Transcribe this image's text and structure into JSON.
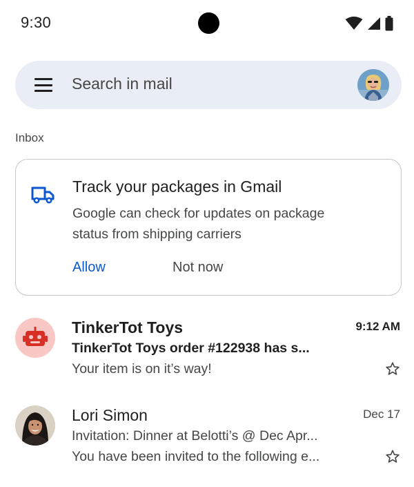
{
  "status_bar": {
    "time": "9:30",
    "icons": [
      "wifi-icon",
      "cell-signal-icon",
      "battery-icon"
    ]
  },
  "search": {
    "placeholder": "Search in mail",
    "menu_icon": "hamburger-menu-icon",
    "account_avatar": "account-avatar"
  },
  "section_label": "Inbox",
  "promo": {
    "icon": "truck-icon",
    "title": "Track your packages in Gmail",
    "body": "Google can check for updates on package status from shipping carriers",
    "allow_label": "Allow",
    "dismiss_label": "Not now"
  },
  "emails": [
    {
      "sender": "TinkerTot Toys",
      "date": "9:12 AM",
      "subject": "TinkerTot Toys order #122938 has s...",
      "snippet": "Your item is on it’s way!",
      "unread": true,
      "avatar": "robot-icon"
    },
    {
      "sender": "Lori Simon",
      "date": "Dec 17",
      "subject": "Invitation: Dinner at Belotti’s @ Dec Apr...",
      "snippet": "You have been invited to the following e...",
      "unread": false,
      "avatar": "contact-photo"
    }
  ],
  "colors": {
    "accent": "#0b57d0",
    "search_bg": "#e9eef6",
    "robot_avatar_bg": "#f9c8c5",
    "robot_icon": "#d93025"
  }
}
